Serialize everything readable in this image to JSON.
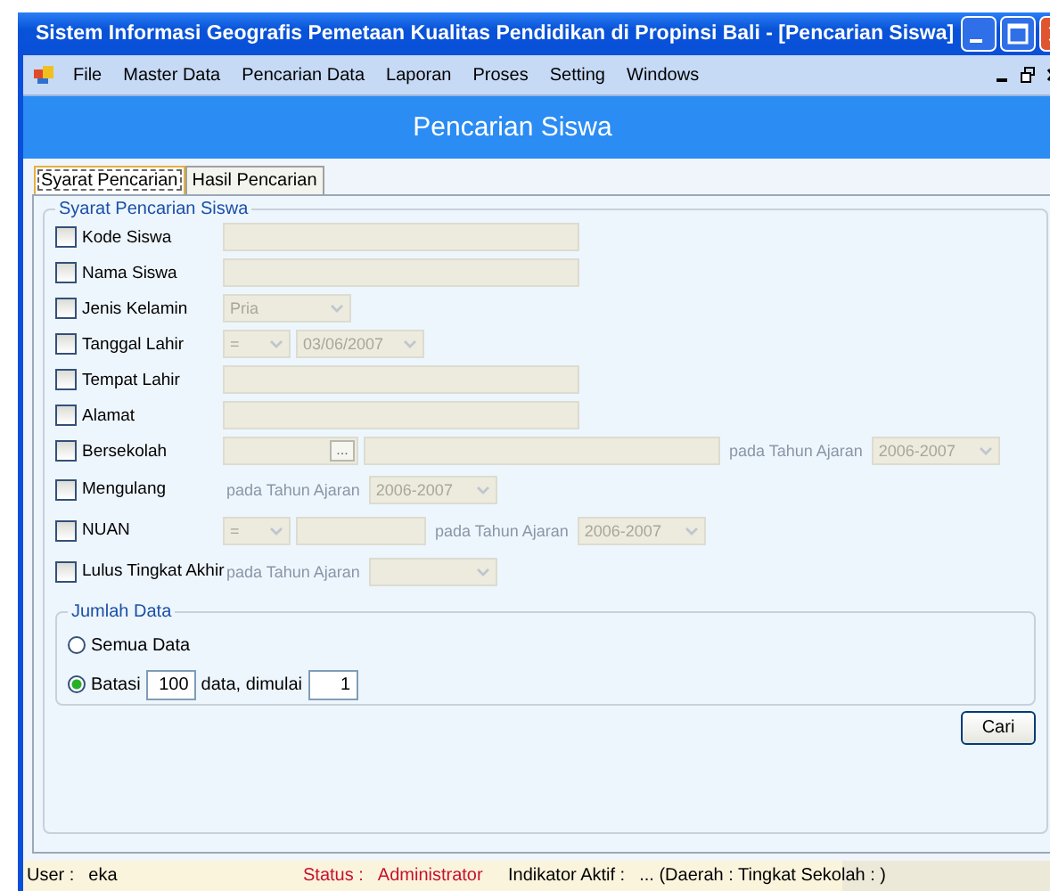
{
  "window": {
    "title": "Sistem Informasi Geografis Pemetaan Kualitas Pendidikan di Propinsi Bali - [Pencarian Siswa]"
  },
  "menu": [
    "File",
    "Master Data",
    "Pencarian Data",
    "Laporan",
    "Proses",
    "Setting",
    "Windows"
  ],
  "header": "Pencarian Siswa",
  "tabs": [
    {
      "label": "Syarat Pencarian",
      "selected": true
    },
    {
      "label": "Hasil Pencarian",
      "selected": false
    }
  ],
  "criteria_group": {
    "title": "Syarat Pencarian Siswa",
    "rows": [
      {
        "label": "Kode Siswa",
        "checked": false,
        "controls": [
          {
            "kind": "field"
          }
        ]
      },
      {
        "label": "Nama Siswa",
        "checked": false,
        "controls": [
          {
            "kind": "field"
          }
        ]
      },
      {
        "label": "Jenis Kelamin",
        "checked": false,
        "controls": [
          {
            "kind": "combo",
            "value": "Pria"
          }
        ]
      },
      {
        "label": "Tanggal Lahir",
        "checked": false,
        "controls": [
          {
            "kind": "small-combo",
            "value": "="
          },
          {
            "kind": "combo",
            "value": "03/06/2007"
          }
        ]
      },
      {
        "label": "Tempat Lahir",
        "checked": false,
        "controls": [
          {
            "kind": "field"
          }
        ]
      },
      {
        "label": "Alamat",
        "checked": false,
        "controls": [
          {
            "kind": "field"
          }
        ]
      },
      {
        "label": "Bersekolah",
        "checked": false,
        "controls": [
          {
            "kind": "browse",
            "value": "..."
          },
          {
            "kind": "field"
          },
          {
            "kind": "note",
            "value": "pada Tahun Ajaran"
          },
          {
            "kind": "combo",
            "value": "2006-2007"
          }
        ]
      },
      {
        "label": "Mengulang",
        "checked": false,
        "controls": [
          {
            "kind": "note",
            "value": "pada Tahun Ajaran"
          },
          {
            "kind": "combo",
            "value": "2006-2007"
          }
        ]
      },
      {
        "label": "NUAN",
        "checked": false,
        "controls": [
          {
            "kind": "small-combo",
            "value": "="
          },
          {
            "kind": "short-field"
          },
          {
            "kind": "note",
            "value": "pada Tahun Ajaran"
          },
          {
            "kind": "combo",
            "value": "2006-2007"
          }
        ]
      },
      {
        "label": "Lulus Tingkat Akhir",
        "checked": false,
        "controls": [
          {
            "kind": "note",
            "value": "pada Tahun Ajaran"
          },
          {
            "kind": "combo"
          }
        ]
      }
    ]
  },
  "amount_group": {
    "title": "Jumlah Data",
    "options": [
      {
        "label": "Semua Data",
        "selected": false
      },
      {
        "label": "Batasi",
        "selected": true,
        "limit": "100",
        "middle": "data, dimulai",
        "start": "1"
      }
    ]
  },
  "search_button": "Cari",
  "status_bar": [
    {
      "label": "User :",
      "value": "eka",
      "kind": "normal"
    },
    {
      "label": "Status :",
      "value": "Administrator",
      "kind": "alert"
    },
    {
      "label": "Indikator Aktif :",
      "value": "...  (Daerah :   Tingkat Sekolah :  )",
      "kind": "normal"
    }
  ]
}
